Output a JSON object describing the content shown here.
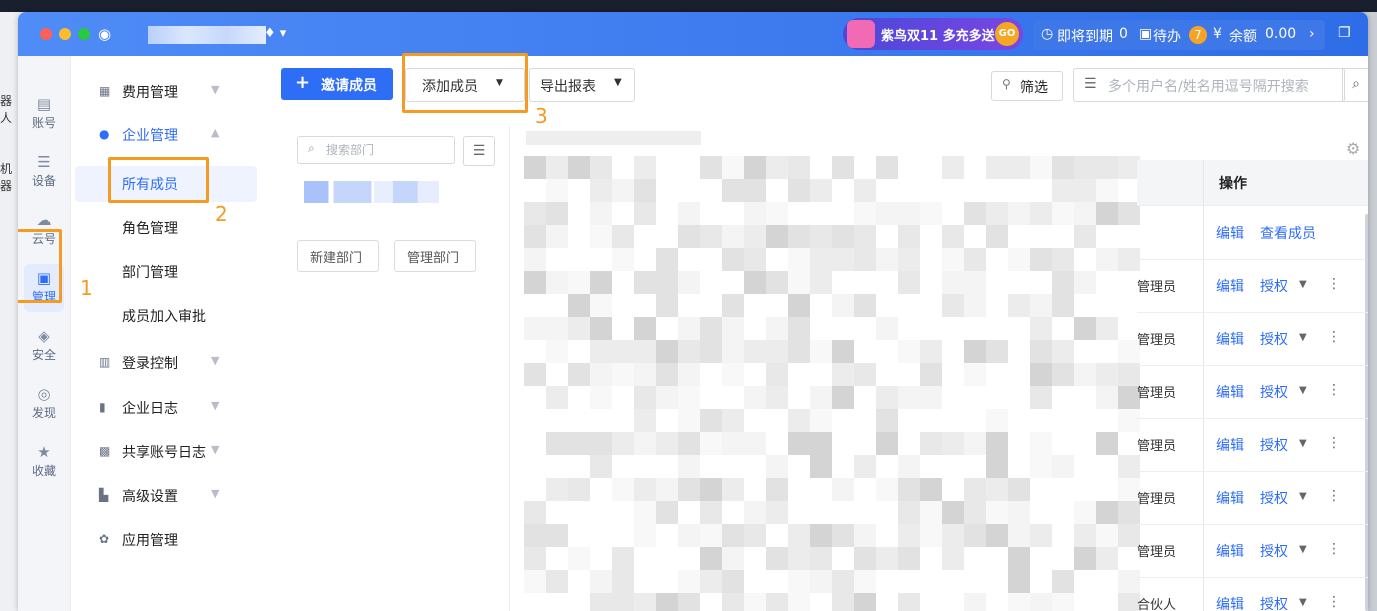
{
  "window": {
    "app_name_blurred": true,
    "promo": {
      "text": "紫鸟双11 多充多送",
      "go": "GO"
    },
    "status": {
      "expiring_label": "即将到期",
      "expiring_count": "0",
      "todo_label": "待办",
      "todo_count": "7",
      "balance_label": "余额",
      "balance_value": "0.00"
    }
  },
  "rail": {
    "items": [
      {
        "label": "账号",
        "icon": "account-icon"
      },
      {
        "label": "设备",
        "icon": "device-icon"
      },
      {
        "label": "云号",
        "icon": "cloud-icon"
      },
      {
        "label": "管理",
        "icon": "manage-icon"
      },
      {
        "label": "安全",
        "icon": "security-icon"
      },
      {
        "label": "发现",
        "icon": "discover-icon"
      },
      {
        "label": "收藏",
        "icon": "star-icon"
      }
    ]
  },
  "nav": {
    "items": [
      {
        "label": "费用管理"
      },
      {
        "label": "企业管理"
      },
      {
        "label": "所有成员"
      },
      {
        "label": "角色管理"
      },
      {
        "label": "部门管理"
      },
      {
        "label": "成员加入审批"
      },
      {
        "label": "登录控制"
      },
      {
        "label": "企业日志"
      },
      {
        "label": "共享账号日志"
      },
      {
        "label": "高级设置"
      },
      {
        "label": "应用管理"
      }
    ]
  },
  "toolbar": {
    "invite": "邀请成员",
    "add_member": "添加成员",
    "export": "导出报表",
    "filter": "筛选",
    "search_placeholder": "多个用户名/姓名用逗号隔开搜索"
  },
  "dept": {
    "search_placeholder": "搜索部门",
    "new_dept": "新建部门",
    "manage_dept": "管理部门"
  },
  "table": {
    "ops_header": "操作",
    "first_row": {
      "edit": "编辑",
      "view": "查看成员"
    },
    "rows": [
      {
        "role": "管理员",
        "edit": "编辑",
        "auth": "授权"
      },
      {
        "role": "管理员",
        "edit": "编辑",
        "auth": "授权"
      },
      {
        "role": "管理员",
        "edit": "编辑",
        "auth": "授权"
      },
      {
        "role": "管理员",
        "edit": "编辑",
        "auth": "授权"
      },
      {
        "role": "管理员",
        "edit": "编辑",
        "auth": "授权"
      },
      {
        "role": "管理员",
        "edit": "编辑",
        "auth": "授权"
      },
      {
        "role": "合伙人",
        "edit": "编辑",
        "auth": "授权"
      }
    ]
  },
  "annotations": [
    "1",
    "2",
    "3"
  ],
  "background_left_text": [
    "器人",
    "机器"
  ],
  "colors": {
    "accent": "#2e6df6",
    "titlebar": "#3d7af0",
    "annotation": "#f59a23",
    "badge": "#f7a326"
  }
}
